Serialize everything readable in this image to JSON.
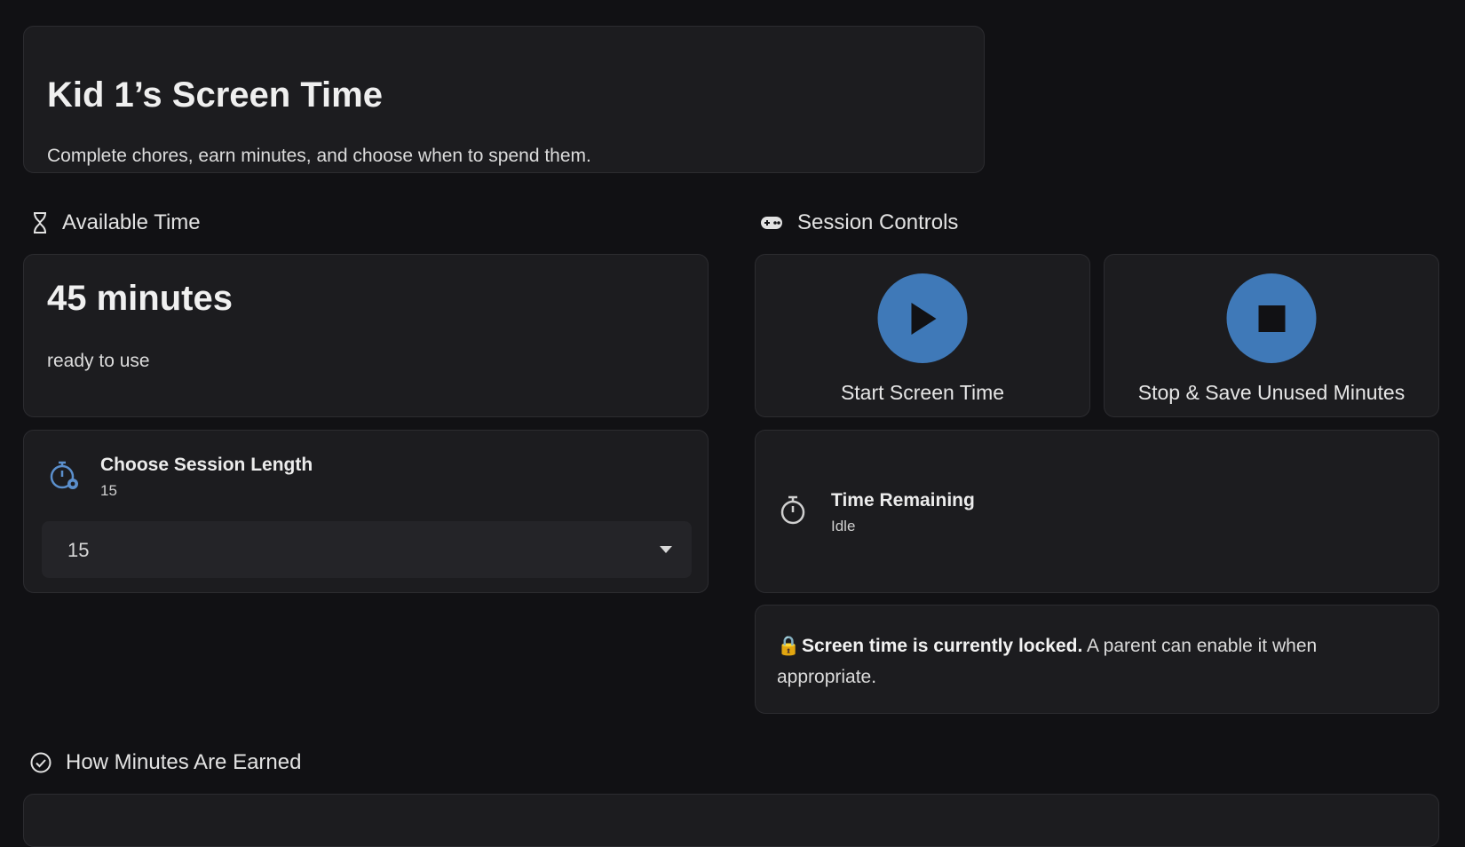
{
  "header": {
    "title": "Kid 1’s Screen Time",
    "subtitle": "Complete chores, earn minutes, and choose when to spend them."
  },
  "available": {
    "section_title": "Available Time",
    "icon": "hourglass-icon",
    "value": "45 minutes",
    "caption": "ready to use"
  },
  "session_length": {
    "icon": "timer-cog-icon",
    "title": "Choose Session Length",
    "current": "15",
    "select_value": "15"
  },
  "session_controls": {
    "section_title": "Session Controls",
    "icon": "gamepad-icon",
    "start_label": "Start Screen Time",
    "stop_label": "Stop & Save Unused Minutes",
    "button_color": "#3f79b8"
  },
  "time_remaining": {
    "icon": "stopwatch-icon",
    "title": "Time Remaining",
    "status": "Idle"
  },
  "lock_notice": {
    "icon": "🔒",
    "bold": "Screen time is currently locked.",
    "text": " A parent can enable it when appropriate."
  },
  "earned": {
    "section_title": "How Minutes Are Earned",
    "icon": "check-circle-icon"
  }
}
